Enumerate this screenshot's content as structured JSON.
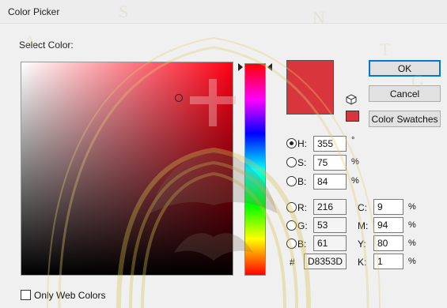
{
  "window": {
    "title": "Color Picker"
  },
  "select_color_label": "Select Color:",
  "buttons": {
    "ok": "OK",
    "cancel": "Cancel",
    "swatches": "Color Swatches"
  },
  "current_color": "#D8353D",
  "hsb": [
    {
      "label": "H:",
      "value": "355",
      "unit": "°",
      "checked": true
    },
    {
      "label": "S:",
      "value": "75",
      "unit": "%",
      "checked": false
    },
    {
      "label": "B:",
      "value": "84",
      "unit": "%",
      "checked": false
    }
  ],
  "rgb": [
    {
      "label": "R:",
      "value": "216"
    },
    {
      "label": "G:",
      "value": "53"
    },
    {
      "label": "B:",
      "value": "61"
    }
  ],
  "cmyk": [
    {
      "label": "C:",
      "value": "9",
      "unit": "%"
    },
    {
      "label": "M:",
      "value": "94",
      "unit": "%"
    },
    {
      "label": "Y:",
      "value": "80",
      "unit": "%"
    },
    {
      "label": "K:",
      "value": "1",
      "unit": "%"
    }
  ],
  "hex": {
    "label": "#",
    "value": "D8353D"
  },
  "only_web_colors": {
    "label": "Only Web Colors",
    "checked": false
  },
  "icons": {
    "gamut": "out-of-gamut-cube-icon"
  }
}
